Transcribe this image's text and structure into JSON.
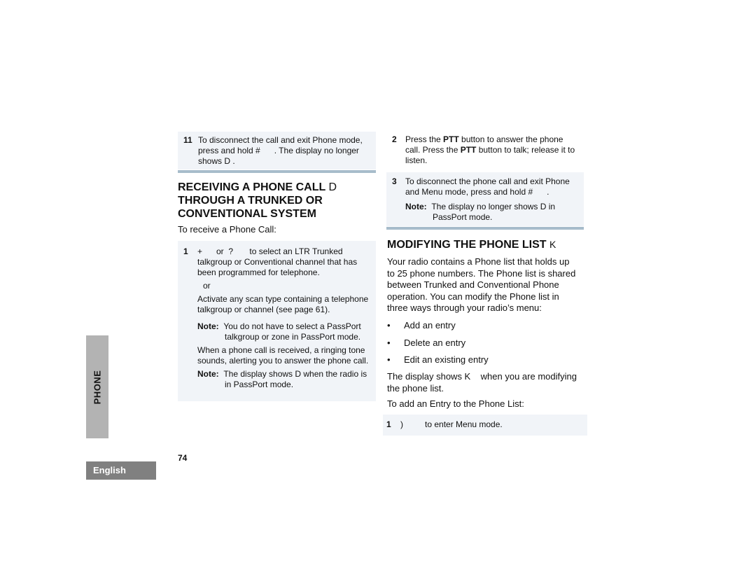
{
  "left_column": {
    "step11": {
      "number": "11",
      "line1": "To disconnect the call and exit Phone mode,",
      "line2": "press and hold #      . The display no longer",
      "line3": "shows D ."
    },
    "section_title": {
      "line1": "RECEIVING A PHONE CALL",
      "symbol": "D",
      "line2": "THROUGH A TRUNKED OR",
      "line3": "CONVENTIONAL SYSTEM"
    },
    "intro": "To receive a Phone Call:",
    "step1": {
      "number": "1",
      "line1": "+      or  ?       to select an LTR Trunked",
      "line2": "talkgroup or Conventional channel that has",
      "line3": "been programmed for telephone.",
      "or": "or",
      "alt_line1": "Activate any scan type containing a telephone",
      "alt_line2": "talkgroup or channel (see page 61).",
      "note1_label": "Note:",
      "note1_text": "You do not have to select a PassPort talkgroup or zone in PassPort mode.",
      "ring_line1": "When a phone call is received, a ringing tone",
      "ring_line2": "sounds, alerting you to answer the phone call.",
      "note2_label": "Note:",
      "note2_text": "The display shows D  when the radio is in PassPort mode."
    }
  },
  "right_column": {
    "step2": {
      "number": "2",
      "pre1": "Press the ",
      "ptt1": "PTT",
      "post1": " button to answer the phone",
      "pre2": "call. Press the ",
      "ptt2": "PTT",
      "post2": " button to talk; release it to",
      "line3": "listen."
    },
    "step3": {
      "number": "3",
      "line1": "To disconnect the phone call and exit Phone",
      "line2": "and Menu mode, press and hold #      .",
      "note_label": "Note:",
      "note_text": "The display no longer shows D  in PassPort mode."
    },
    "section_title": {
      "text": "MODIFYING THE PHONE LIST",
      "symbol": "K"
    },
    "intro_lines": [
      "Your radio contains a Phone list that holds up",
      "to 25 phone numbers. The Phone list is shared",
      "between Trunked and Conventional Phone",
      "operation. You can modify the Phone list in",
      "three ways through your radio’s menu:"
    ],
    "bullets": [
      "Add an entry",
      "Delete an entry",
      "Edit an existing entry"
    ],
    "bullet_glyph": "•",
    "display_line1": "The display shows K    when you are modifying",
    "display_line2": "the phone list.",
    "add_intro": "To add an Entry to the Phone List:",
    "step1": {
      "number": "1",
      "key": ")",
      "text": "to enter Menu mode."
    }
  },
  "side_tab": "PHONE",
  "language_tab": "English",
  "page_number": "74"
}
